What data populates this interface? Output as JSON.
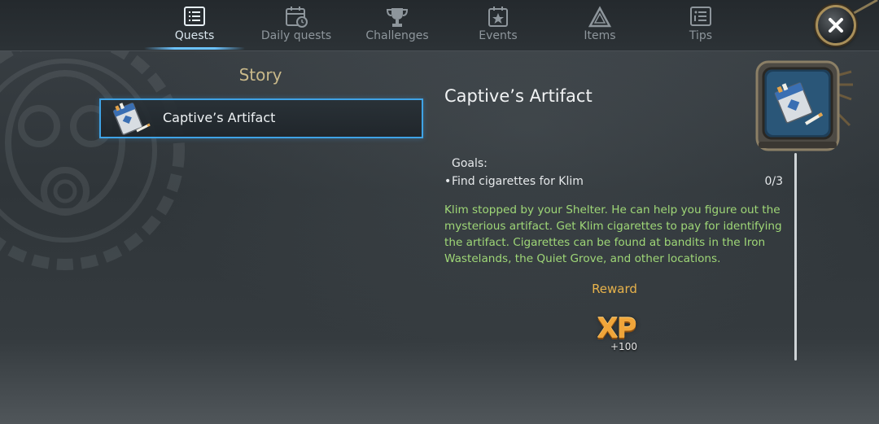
{
  "tabs": [
    {
      "label": "Quests",
      "icon": "list-icon",
      "active": true
    },
    {
      "label": "Daily quests",
      "icon": "calendar-clock-icon",
      "active": false
    },
    {
      "label": "Challenges",
      "icon": "trophy-icon",
      "active": false
    },
    {
      "label": "Events",
      "icon": "calendar-star-icon",
      "active": false
    },
    {
      "label": "Items",
      "icon": "triangle-icon",
      "active": false
    },
    {
      "label": "Tips",
      "icon": "tips-list-icon",
      "active": false
    }
  ],
  "quest_list": {
    "section_title": "Story",
    "items": [
      {
        "name": "Captive’s Artifact",
        "icon": "cigarette-pack-icon",
        "selected": true
      }
    ]
  },
  "detail": {
    "title": "Captive’s Artifact",
    "goals_label": "Goals:",
    "goals": [
      {
        "bullet": "•",
        "text": "Find cigarettes for Klim",
        "progress": "0/3"
      }
    ],
    "description": "Klim stopped by your Shelter. He can help you figure out the mysterious artifact. Get Klim cigarettes to pay for identifying the artifact. Cigarettes can be found at bandits in the Iron Wastelands, the Quiet Grove, and other locations.",
    "reward_label": "Reward",
    "reward": {
      "type": "XP",
      "amount": "+100"
    }
  },
  "colors": {
    "accent_blue": "#3fa3e6",
    "section_gold": "#c9b98a",
    "description_green": "#9fd777",
    "reward_orange": "#e8b34b"
  }
}
